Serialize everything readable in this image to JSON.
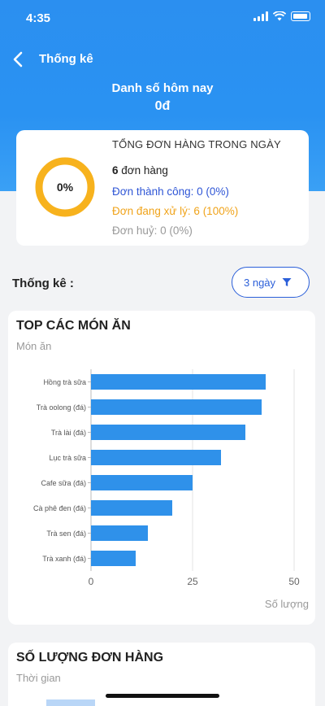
{
  "status_bar": {
    "time": "4:35"
  },
  "nav": {
    "title": "Thống kê"
  },
  "sales": {
    "label": "Danh số hôm nay",
    "value": "0đ"
  },
  "summary": {
    "donut_label": "0%",
    "success_fraction": 0,
    "title": "TỔNG ĐƠN HÀNG TRONG NGÀY",
    "orders_count": "6",
    "orders_unit": "đơn hàng",
    "success": "Đơn thành công: 0 (0%)",
    "processing": "Đơn đang xử lý: 6 (100%)",
    "cancelled": "Đơn huỷ: 0 (0%)"
  },
  "stats": {
    "label": "Thống kê :",
    "filter_label": "3 ngày"
  },
  "colors": {
    "primary": "#2b8ff0",
    "donut": "#f7b21d",
    "bar": "#2f91ea",
    "success_text": "#2f56d6",
    "processing_text": "#f0a31a"
  },
  "chart_data": {
    "type": "bar",
    "orientation": "horizontal",
    "title": "TOP CÁC MÓN ĂN",
    "subtitle": "Món ăn",
    "categories": [
      "Hồng trà sữa",
      "Trà oolong (đá)",
      "Trà lài (đá)",
      "Lục trà sữa",
      "Cafe sữa (đá)",
      "Cà phê đen (đá)",
      "Trà sen (đá)",
      "Trà xanh (đá)"
    ],
    "values": [
      43,
      42,
      38,
      32,
      25,
      20,
      14,
      11
    ],
    "xlim": [
      0,
      50
    ],
    "xticks": [
      "0",
      "25",
      "50"
    ],
    "xlabel": "Số lượng",
    "grid": true
  },
  "orders_chart": {
    "title": "SỐ LƯỢNG ĐƠN HÀNG",
    "subtitle": "Thời gian"
  }
}
